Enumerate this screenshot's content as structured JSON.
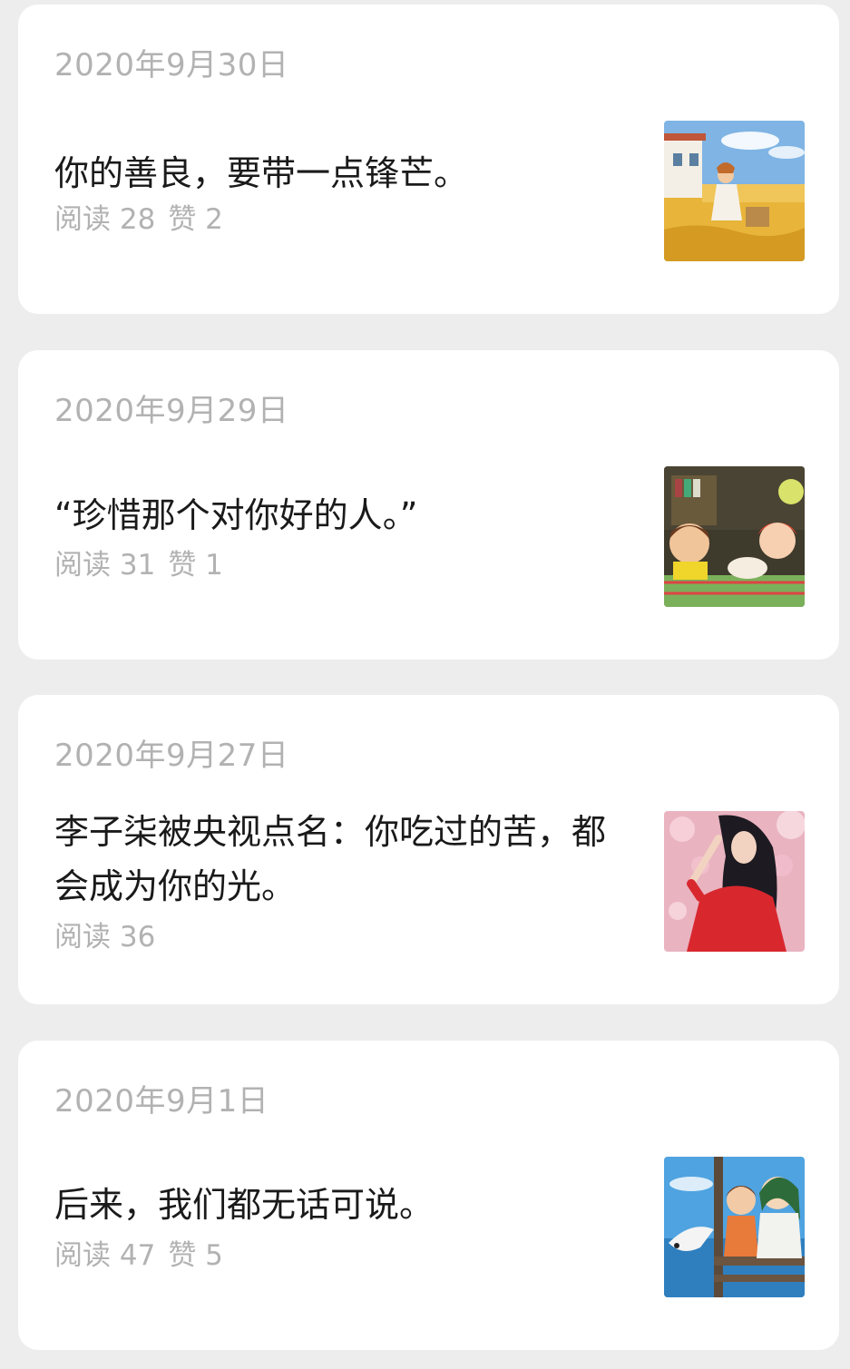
{
  "articles": [
    {
      "date": "2020年9月30日",
      "title": "你的善良，要带一点锋芒。",
      "read_label": "阅读 28",
      "like_label": "赞 2"
    },
    {
      "date": "2020年9月29日",
      "title": "“珍惜那个对你好的人。”",
      "read_label": "阅读 31",
      "like_label": "赞 1"
    },
    {
      "date": "2020年9月27日",
      "title": "李子柒被央视点名：你吃过的苦，都会成为你的光。",
      "read_label": "阅读 36",
      "like_label": ""
    },
    {
      "date": "2020年9月1日",
      "title": "后来，我们都无话可说。",
      "read_label": "阅读 47",
      "like_label": "赞 5"
    }
  ],
  "colors": {
    "background": "#ededed",
    "card": "#ffffff",
    "meta_text": "#b2b2b2",
    "title_text": "#1a1a1a"
  }
}
